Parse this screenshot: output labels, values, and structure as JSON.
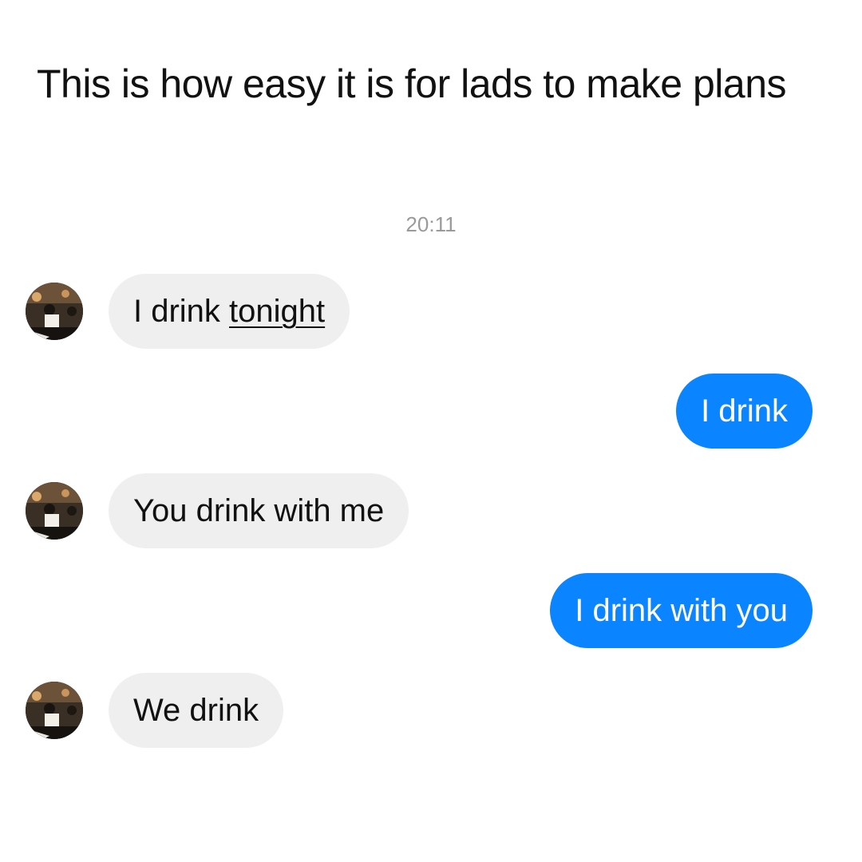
{
  "caption": "This is how easy it is for lads to make plans",
  "timestamp": "20:11",
  "colors": {
    "incoming_bubble": "#efefef",
    "outgoing_bubble": "#0a84ff",
    "timestamp_text": "#9a9a9a"
  },
  "messages": [
    {
      "direction": "incoming",
      "text_plain": "I drink ",
      "text_underlined": "tonight",
      "avatar": "profile-photo-avatar"
    },
    {
      "direction": "outgoing",
      "text": "I drink"
    },
    {
      "direction": "incoming",
      "text": "You drink with me",
      "avatar": "profile-photo-avatar"
    },
    {
      "direction": "outgoing",
      "text": "I drink with you"
    },
    {
      "direction": "incoming",
      "text": "We drink",
      "avatar": "profile-photo-avatar"
    }
  ]
}
